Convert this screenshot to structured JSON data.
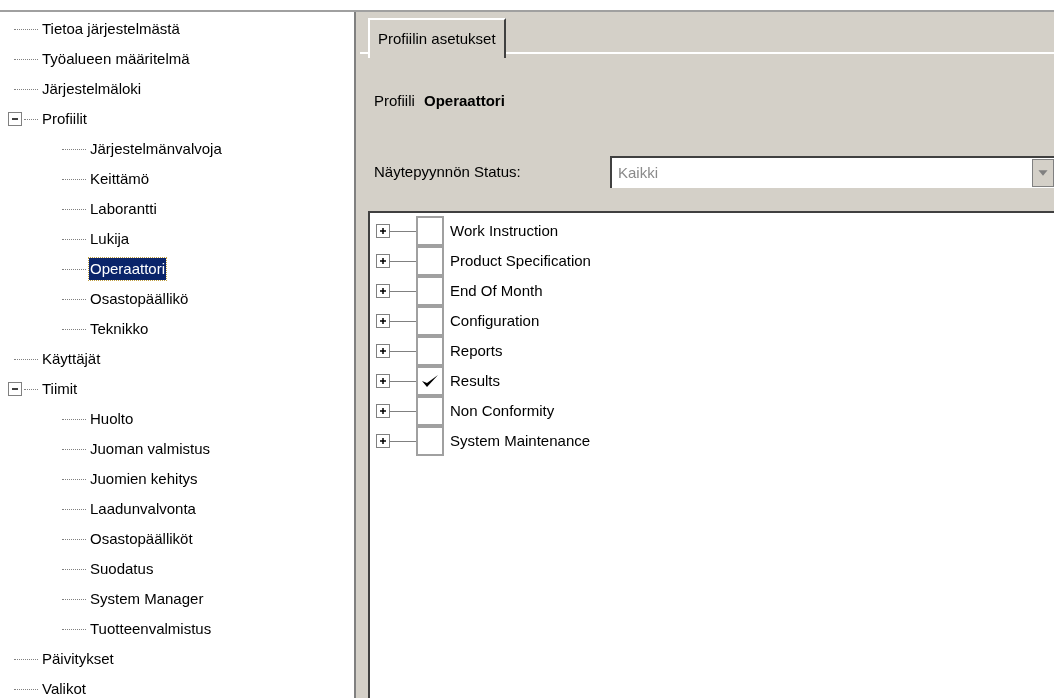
{
  "sidebar": {
    "items": [
      {
        "label": "Tietoa järjestelmästä",
        "selected": false
      },
      {
        "label": "Työalueen määritelmä",
        "selected": false
      },
      {
        "label": "Järjestelmäloki",
        "selected": false
      },
      {
        "label": "Profiilit",
        "selected": false,
        "expanded": true,
        "children": [
          {
            "label": "Järjestelmänvalvoja",
            "selected": false
          },
          {
            "label": "Keittämö",
            "selected": false
          },
          {
            "label": "Laborantti",
            "selected": false
          },
          {
            "label": "Lukija",
            "selected": false
          },
          {
            "label": "Operaattori",
            "selected": true
          },
          {
            "label": "Osastopäällikö",
            "selected": false
          },
          {
            "label": "Teknikko",
            "selected": false
          }
        ]
      },
      {
        "label": "Käyttäjät",
        "selected": false
      },
      {
        "label": "Tiimit",
        "selected": false,
        "expanded": true,
        "children": [
          {
            "label": "Huolto",
            "selected": false
          },
          {
            "label": "Juoman valmistus",
            "selected": false
          },
          {
            "label": "Juomien kehitys",
            "selected": false
          },
          {
            "label": "Laadunvalvonta",
            "selected": false
          },
          {
            "label": "Osastopäälliköt",
            "selected": false
          },
          {
            "label": "Suodatus",
            "selected": false
          },
          {
            "label": "System Manager",
            "selected": false
          },
          {
            "label": "Tuotteenvalmistus",
            "selected": false
          }
        ]
      },
      {
        "label": "Päivitykset",
        "selected": false
      },
      {
        "label": "Valikot",
        "selected": false
      }
    ]
  },
  "tabs": [
    {
      "label": "Profiilin asetukset",
      "selected": true
    }
  ],
  "profile": {
    "label": "Profiili",
    "value": "Operaattori"
  },
  "status": {
    "label": "Näytepyynnön Status:",
    "value": "Kaikki",
    "disabled": true
  },
  "permissions": [
    {
      "label": "Work Instruction",
      "checked": false,
      "expanded": false
    },
    {
      "label": "Product Specification",
      "checked": false,
      "expanded": false
    },
    {
      "label": "End Of Month",
      "checked": false,
      "expanded": false
    },
    {
      "label": "Configuration",
      "checked": false,
      "expanded": false
    },
    {
      "label": "Reports",
      "checked": false,
      "expanded": false
    },
    {
      "label": "Results",
      "checked": true,
      "expanded": false
    },
    {
      "label": "Non Conformity",
      "checked": false,
      "expanded": false
    },
    {
      "label": "System Maintenance",
      "checked": false,
      "expanded": false
    }
  ]
}
